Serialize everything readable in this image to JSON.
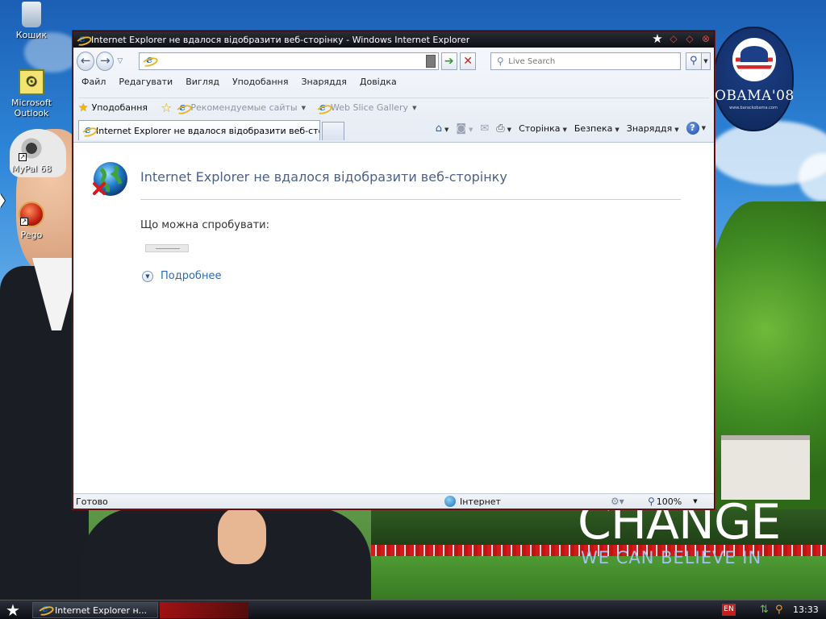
{
  "desktop": {
    "icons": [
      {
        "label": "Кошик",
        "icon": "recycle-bin-icon"
      },
      {
        "label": "Microsoft Outlook",
        "icon": "outlook-icon"
      },
      {
        "label": "MyPal 68",
        "icon": "mypal-icon"
      },
      {
        "label": "Pego",
        "icon": "pego-icon"
      }
    ],
    "wallpaper": {
      "badge_text": "OBAMA'08",
      "badge_subtext": "www.barackobama.com",
      "headline": "CHANGE",
      "subheadline": "WE CAN BELIEVE IN"
    }
  },
  "window": {
    "title": "Internet Explorer не вдалося відобразити веб-сторінку - Windows Internet Explorer",
    "address_value": "",
    "search_placeholder": "Live Search",
    "menu": [
      "Файл",
      "Редагувати",
      "Вигляд",
      "Уподобання",
      "Знаряддя",
      "Довідка"
    ],
    "favorites": {
      "main_label": "Уподобання",
      "links": [
        {
          "label": "Рекомендуемые сайты"
        },
        {
          "label": "Web Slice Gallery"
        }
      ]
    },
    "tab_label": "Internet Explorer не вдалося відобразити веб-сторі...",
    "commands": {
      "page": "Сторінка",
      "safety": "Безпека",
      "tools": "Знаряддя"
    },
    "content": {
      "heading": "Internet Explorer не вдалося відобразити веб-сторінку",
      "try_label": "Що можна спробувати:",
      "more_label": "Подробнее"
    },
    "status": {
      "text": "Готово",
      "zone": "Інтернет",
      "zoom": "100%"
    }
  },
  "taskbar": {
    "task_label": "Internet Explorer н...",
    "language": "EN",
    "clock": "13:33"
  },
  "colors": {
    "title_bar": "#0d0f14",
    "heading_text": "#4d6185",
    "link_text": "#2a6ab8"
  }
}
